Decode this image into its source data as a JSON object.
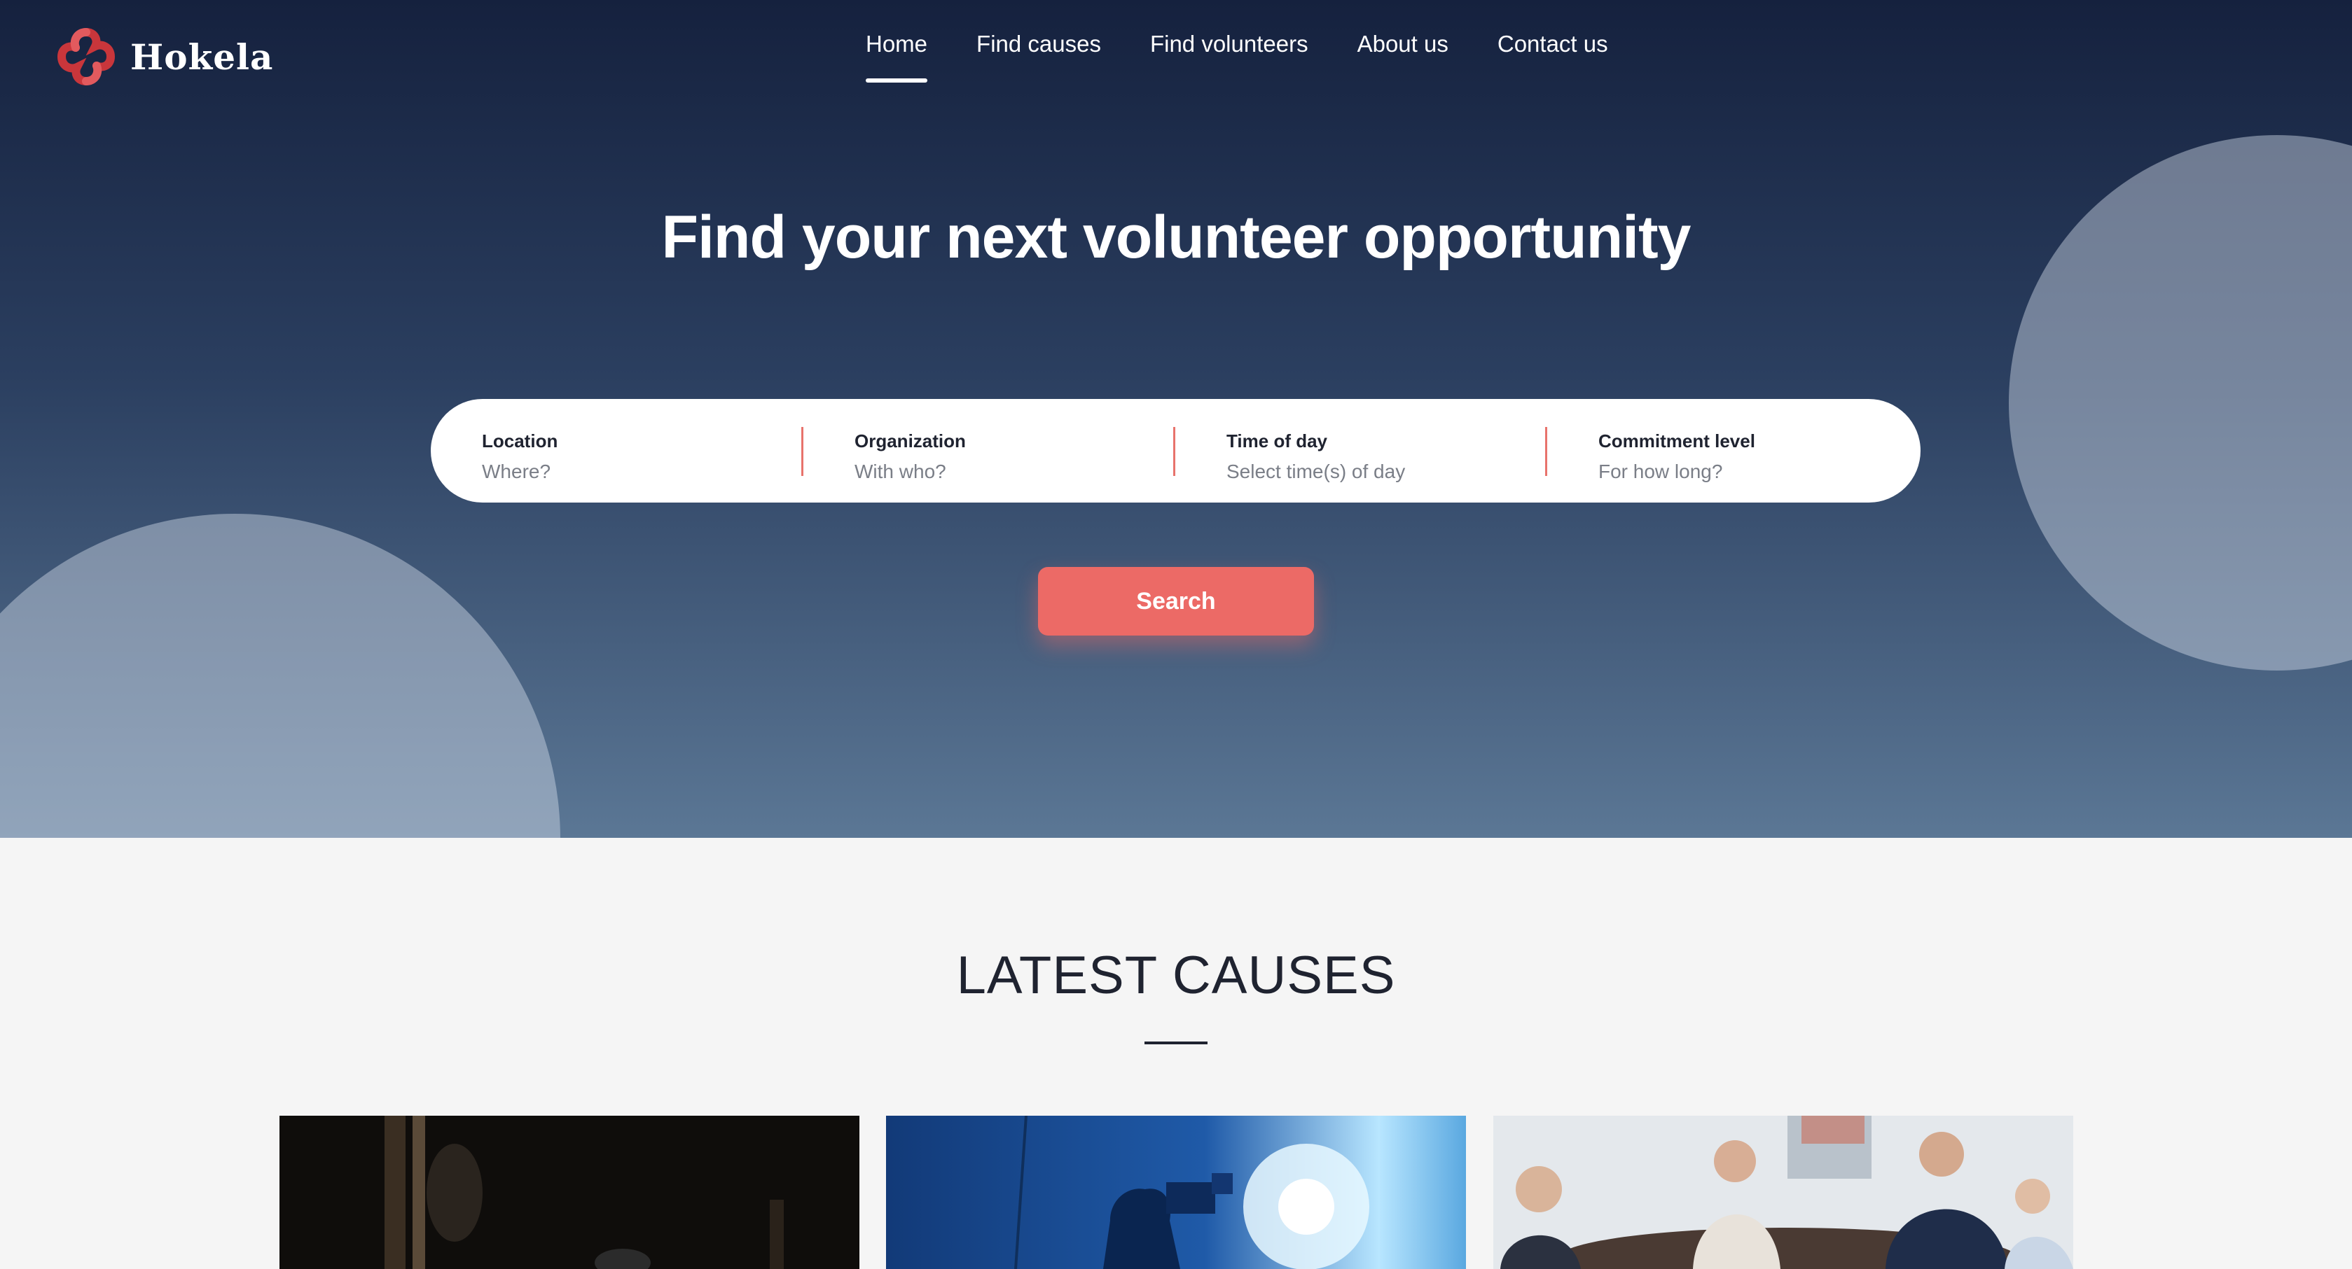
{
  "brand": {
    "name": "Hokela",
    "logo_icon": "hokela-cross-logo-icon",
    "accent_color": "#ec6a66"
  },
  "nav": {
    "items": [
      {
        "label": "Home",
        "active": true
      },
      {
        "label": "Find causes",
        "active": false
      },
      {
        "label": "Find volunteers",
        "active": false
      },
      {
        "label": "About us",
        "active": false
      },
      {
        "label": "Contact us",
        "active": false
      }
    ]
  },
  "hero": {
    "title": "Find your next volunteer opportunity"
  },
  "search": {
    "fields": [
      {
        "label": "Location",
        "placeholder": "Where?"
      },
      {
        "label": "Organization",
        "placeholder": "With who?"
      },
      {
        "label": "Time of day",
        "placeholder": "Select time(s) of day"
      },
      {
        "label": "Commitment level",
        "placeholder": "For how long?"
      }
    ],
    "button_label": "Search"
  },
  "latest_causes": {
    "title": "LATEST CAUSES",
    "cards": [
      {
        "image": "dark-studio-photo"
      },
      {
        "image": "camera-operator-blue-light-photo"
      },
      {
        "image": "business-meeting-photo"
      }
    ]
  }
}
